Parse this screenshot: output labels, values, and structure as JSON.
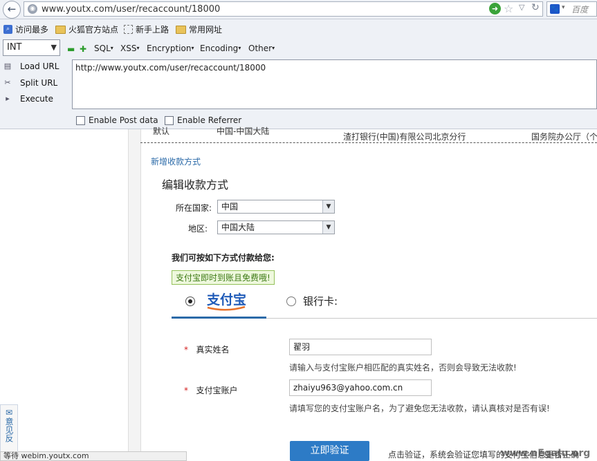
{
  "browser": {
    "url": "www.youtx.com/user/recaccount/18000",
    "search_engine": "百度",
    "bookmarks": [
      "访问最多",
      "火狐官方站点",
      "新手上路",
      "常用网址"
    ]
  },
  "hackbar": {
    "type_select": "INT",
    "menus": [
      "SQL",
      "XSS",
      "Encryption",
      "Encoding",
      "Other"
    ],
    "buttons": [
      "Load URL",
      "Split URL",
      "Execute"
    ],
    "url_value": "http://www.youtx.com/user/recaccount/18000",
    "checkboxes": [
      "Enable Post data",
      "Enable Referrer"
    ]
  },
  "page": {
    "table_row": [
      "默认",
      "中国-中国大陆",
      "渣打银行(中国)有限公司北京分行",
      "国务院办公厅（个"
    ],
    "add_link": "新增收款方式",
    "title": "编辑收款方式",
    "country_label": "所在国家:",
    "country_value": "中国",
    "region_label": "地区:",
    "region_value": "中国大陆",
    "pay_heading": "我们可按如下方式付款给您:",
    "tip": "支付宝即时到账且免费哦!",
    "alipay_logo_text": "支付宝",
    "bank_card": "银行卡:",
    "required_mark": "*",
    "name_label": "真实姓名",
    "name_value": "翟羽",
    "name_hint": "请输入与支付宝账户相匹配的真实姓名，否则会导致无法收款!",
    "account_label": "支付宝账户",
    "account_value": "zhaiyu963@yahoo.com.cn",
    "account_hint": "请填写您的支付宝账户名，为了避免您无法收款，请认真核对是否有误!",
    "verify_button": "立即验证",
    "verify_hint": "点击验证，系统会验证您填写的支付宝信息是否正确",
    "feedback": "意见反",
    "status": "等待 webim.youtx.com",
    "watermark": "www.nEgaJu.org"
  },
  "colors": {
    "accent": "#2d7bc6",
    "tip_green": "#3d7a14",
    "required": "#d42020"
  }
}
